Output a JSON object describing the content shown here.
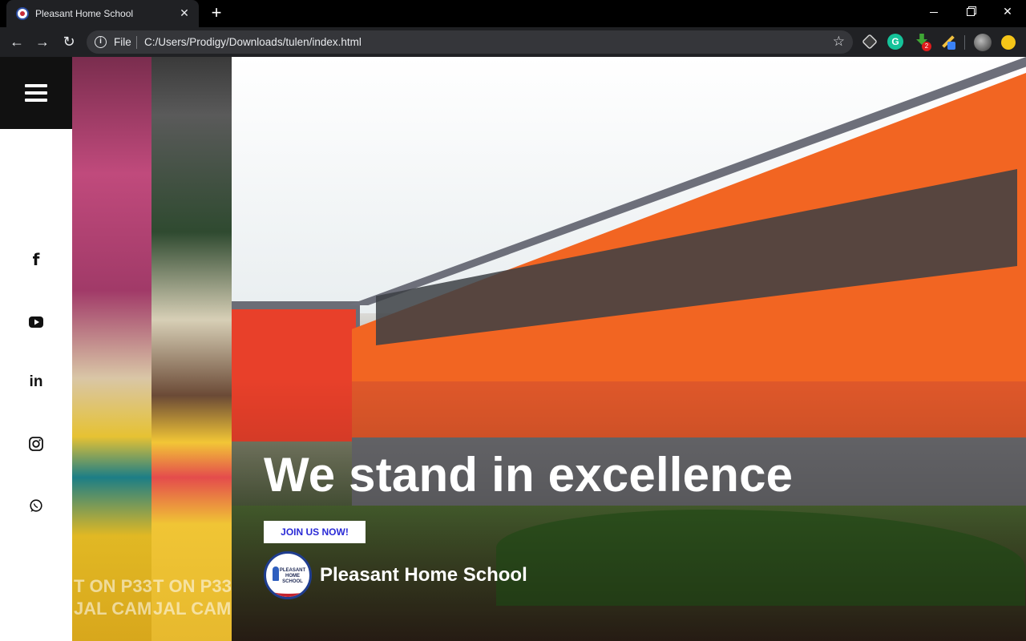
{
  "browser": {
    "tab_title": "Pleasant Home School",
    "tab_close": "✕",
    "new_tab": "+",
    "scheme_label": "File",
    "url": "C:/Users/Prodigy/Downloads/tulen/index.html",
    "extensions": [
      "cube-extension-icon",
      "grammarly-icon",
      "downloader-icon",
      "pen-tool-icon",
      "profile-avatar",
      "update-alert-icon"
    ],
    "download_badge": "2",
    "grammarly_letter": "G"
  },
  "sidebar": {
    "menu_icon": "hamburger-menu-icon",
    "social": [
      {
        "name": "facebook",
        "glyph": "f"
      },
      {
        "name": "youtube",
        "glyph": ""
      },
      {
        "name": "linkedin",
        "glyph": "in"
      },
      {
        "name": "instagram",
        "glyph": ""
      },
      {
        "name": "whatsapp",
        "glyph": ""
      }
    ]
  },
  "strips": {
    "text_line1": "T ON P33",
    "text_line2": "JAL CAM"
  },
  "hero": {
    "headline": "We stand in excellence",
    "cta_label": "JOIN US NOW!",
    "brand_name": "Pleasant Home School",
    "logo_text": "PLEASANT HOME SCHOOL"
  },
  "colors": {
    "accent_orange": "#f26522",
    "cta_text": "#2a2ad6",
    "menu_box": "#111111"
  }
}
